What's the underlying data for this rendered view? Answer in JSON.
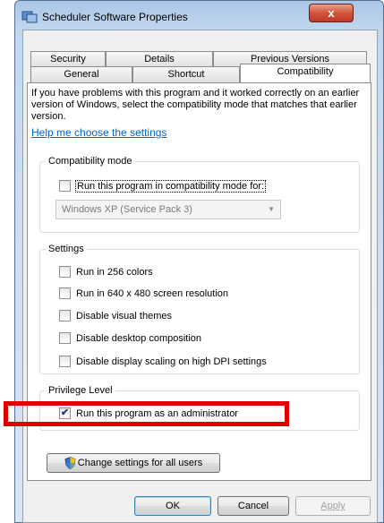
{
  "window": {
    "title": "Scheduler Software Properties",
    "close_label": "x"
  },
  "tabs": {
    "row1": [
      "Security",
      "Details",
      "Previous Versions"
    ],
    "row2": [
      "General",
      "Shortcut",
      "Compatibility"
    ],
    "active": "Compatibility"
  },
  "intro": {
    "text": "If you have problems with this program and it worked correctly on an earlier version of Windows, select the compatibility mode that matches that earlier version.",
    "link": "Help me choose the settings"
  },
  "compatibility_mode": {
    "label": "Compatibility mode",
    "checkbox_label": "Run this program in compatibility mode for:",
    "checked": false,
    "selected_os": "Windows XP (Service Pack 3)"
  },
  "settings": {
    "label": "Settings",
    "items": [
      {
        "label": "Run in 256 colors",
        "checked": false
      },
      {
        "label": "Run in 640 x 480 screen resolution",
        "checked": false
      },
      {
        "label": "Disable visual themes",
        "checked": false
      },
      {
        "label": "Disable desktop composition",
        "checked": false
      },
      {
        "label": "Disable display scaling on high DPI settings",
        "checked": false
      }
    ]
  },
  "privilege": {
    "label": "Privilege Level",
    "checkbox_label": "Run this program as an administrator",
    "checked": true
  },
  "change_settings_button": "Change settings for all users",
  "buttons": {
    "ok": "OK",
    "cancel": "Cancel",
    "apply": "Apply"
  },
  "colors": {
    "highlight": "#e00000",
    "link": "#0066cc",
    "close": "#c0392b"
  }
}
